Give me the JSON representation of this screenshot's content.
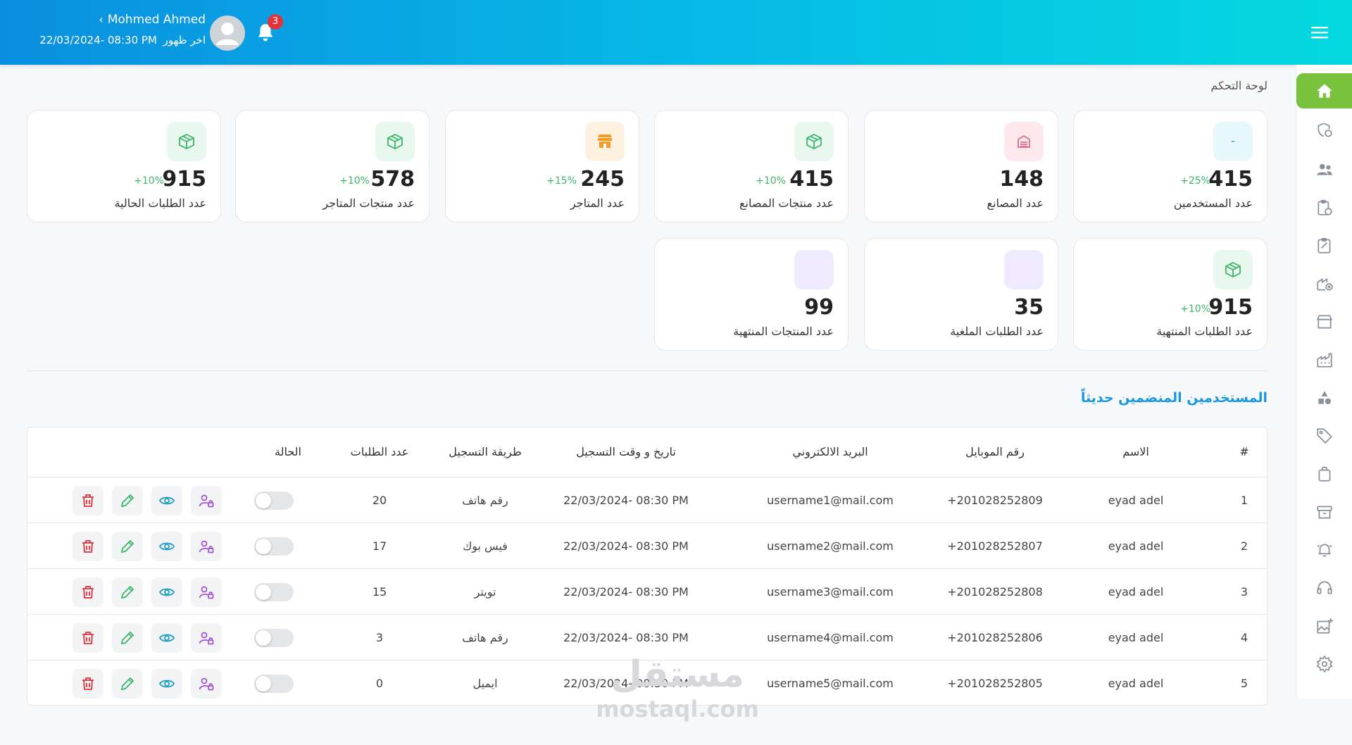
{
  "header": {
    "user_name": "Mohmed Ahmed",
    "last_seen_label": "اخر ظهور",
    "last_seen_value": "22/03/2024- 08:30 PM",
    "notification_count": "3"
  },
  "breadcrumb": "لوحة التحكم",
  "colors": {
    "accent": "#79c23d",
    "brand_blue": "#1898e0",
    "positive": "#3db66b",
    "danger": "#e0333b"
  },
  "cards": [
    {
      "title": "عدد المستخدمين",
      "value": "415",
      "change": "+25%",
      "icon": "dash-icon"
    },
    {
      "title": "عدد المصانع",
      "value": "148",
      "change": "",
      "icon": "factory-icon"
    },
    {
      "title": "عدد منتجات المصانع",
      "value": "415",
      "change": "+10%",
      "icon": "box-icon"
    },
    {
      "title": "عدد المتاجر",
      "value": "245",
      "change": "+15%",
      "icon": "store-icon"
    },
    {
      "title": "عدد منتجات المتاجر",
      "value": "578",
      "change": "+10%",
      "icon": "box-icon"
    },
    {
      "title": "عدد الطلبات الحالية",
      "value": "915",
      "change": "+10%",
      "icon": "box-icon"
    },
    {
      "title": "عدد الطلبات المنتهية",
      "value": "915",
      "change": "+10%",
      "icon": "box-icon"
    },
    {
      "title": "عدد الطلبات الملغية",
      "value": "35",
      "change": "",
      "icon": "blank-icon"
    },
    {
      "title": "عدد المنتجات المنتهية",
      "value": "99",
      "change": "",
      "icon": "blank-icon"
    }
  ],
  "section_title": "المستخدمين المنضمين حديثاً",
  "table": {
    "headers": [
      "#",
      "الاسم",
      "رقم الموبايل",
      "البريد الالكتروني",
      "تاريخ و وقت التسجيل",
      "طريقة التسجيل",
      "عدد الطلبات",
      "الحالة"
    ],
    "rows": [
      {
        "num": "1",
        "name": "eyad adel",
        "phone": "+201028252809",
        "email": "username1@mail.com",
        "date": "22/03/2024- 08:30 PM",
        "method": "رقم هاتف",
        "orders": "20"
      },
      {
        "num": "2",
        "name": "eyad adel",
        "phone": "+201028252807",
        "email": "username2@mail.com",
        "date": "22/03/2024- 08:30 PM",
        "method": "فيس بوك",
        "orders": "17"
      },
      {
        "num": "3",
        "name": "eyad adel",
        "phone": "+201028252808",
        "email": "username3@mail.com",
        "date": "22/03/2024- 08:30 PM",
        "method": "تويتر",
        "orders": "15"
      },
      {
        "num": "4",
        "name": "eyad adel",
        "phone": "+201028252806",
        "email": "username4@mail.com",
        "date": "22/03/2024- 08:30 PM",
        "method": "رقم هاتف",
        "orders": "3"
      },
      {
        "num": "5",
        "name": "eyad adel",
        "phone": "+201028252805",
        "email": "username5@mail.com",
        "date": "22/03/2024- 08:30 PM",
        "method": "ايميل",
        "orders": "0"
      }
    ]
  },
  "watermark": {
    "arabic": "مستقل",
    "latin": "mostaql.com"
  }
}
